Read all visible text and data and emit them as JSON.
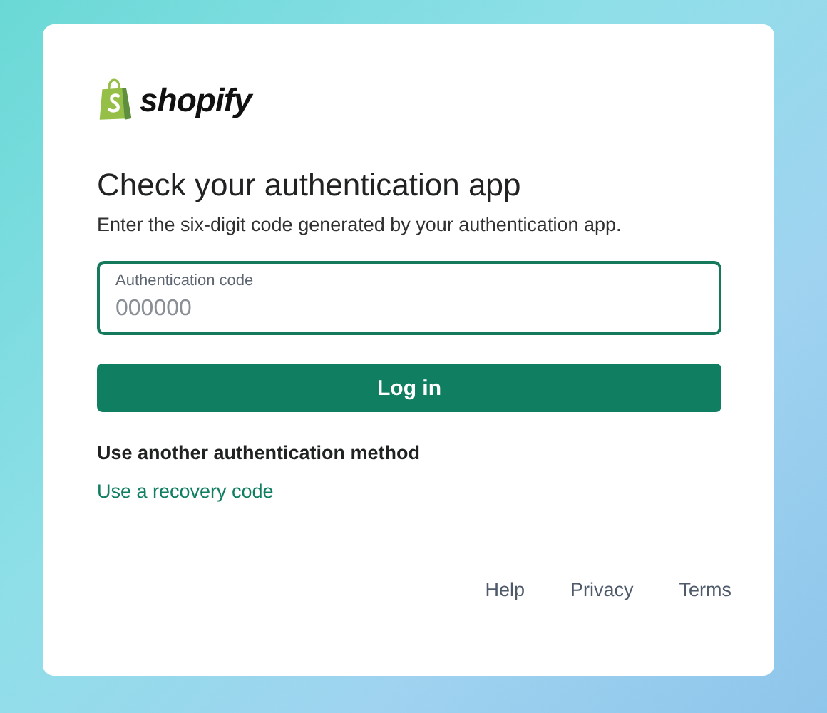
{
  "logo": {
    "wordmark": "shopify"
  },
  "heading": "Check your authentication app",
  "subtitle": "Enter the six-digit code generated by your authentication app.",
  "code_field": {
    "label": "Authentication code",
    "placeholder": "000000"
  },
  "submit_button": "Log in",
  "alternative": {
    "title": "Use another authentication method",
    "links": [
      "Use a recovery code"
    ]
  },
  "footer_links": [
    "Help",
    "Privacy",
    "Terms"
  ]
}
